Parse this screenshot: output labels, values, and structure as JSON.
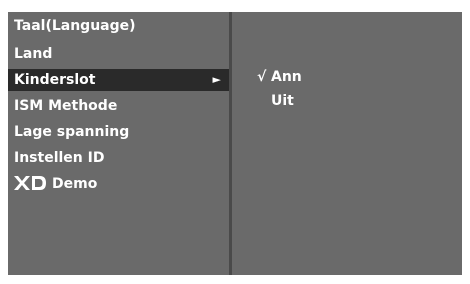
{
  "menu": {
    "items": [
      {
        "label": "Taal(Language)"
      },
      {
        "label": "Land"
      },
      {
        "label": "Kinderslot",
        "arrow": "►"
      },
      {
        "label": "ISM Methode"
      },
      {
        "label": "Lage spanning"
      },
      {
        "label": "Instellen ID"
      },
      {
        "label": "Demo",
        "icon": "xd-logo-icon"
      }
    ],
    "selected_index": 2
  },
  "submenu": {
    "options": [
      {
        "check": "√",
        "label": "Ann"
      },
      {
        "check": "",
        "label": "Uit"
      }
    ],
    "checked_index": 0
  },
  "colors": {
    "panel_bg": "#6a6a6a",
    "selected_bg": "#2a2a2a",
    "divider": "#4a4a4a",
    "text": "#ffffff"
  }
}
